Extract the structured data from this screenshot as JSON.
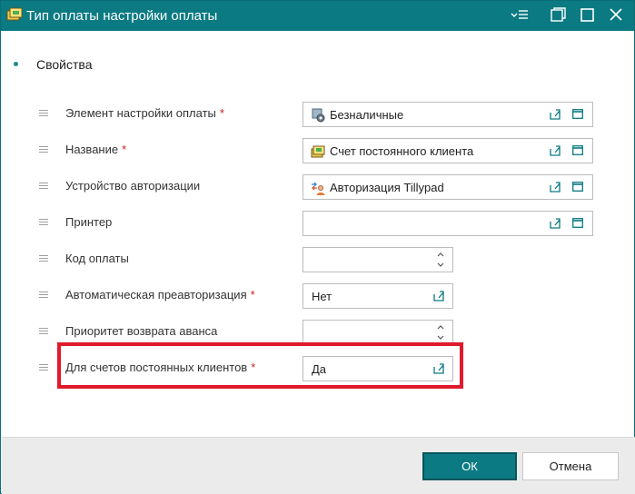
{
  "window": {
    "title": "Тип оплаты настройки оплаты"
  },
  "section": {
    "title": "Свойства"
  },
  "fields": [
    {
      "label": "Элемент настройки оплаты",
      "required": "*",
      "value": "Безналичные",
      "icon": "payment-config-icon"
    },
    {
      "label": "Название",
      "required": "*",
      "value": "Счет постоянного клиента",
      "icon": "money-icon"
    },
    {
      "label": "Устройство авторизации",
      "required": "",
      "value": "Авторизация Tillypad",
      "icon": "auth-device-icon"
    },
    {
      "label": "Принтер",
      "required": "",
      "value": "",
      "icon": ""
    },
    {
      "label": "Код оплаты",
      "required": "",
      "value": "",
      "icon": ""
    },
    {
      "label": "Автоматическая преавторизация",
      "required": "*",
      "value": "Нет",
      "icon": ""
    },
    {
      "label": "Приоритет возврата аванса",
      "required": "",
      "value": "",
      "icon": ""
    },
    {
      "label": "Для счетов постоянных клиентов",
      "required": "*",
      "value": "Да",
      "icon": ""
    }
  ],
  "footer": {
    "ok_label": "ОК",
    "cancel_label": "Отмена"
  },
  "colors": {
    "accent": "#0b7a82",
    "required": "#cc1f1f",
    "highlight": "#e0192b"
  }
}
